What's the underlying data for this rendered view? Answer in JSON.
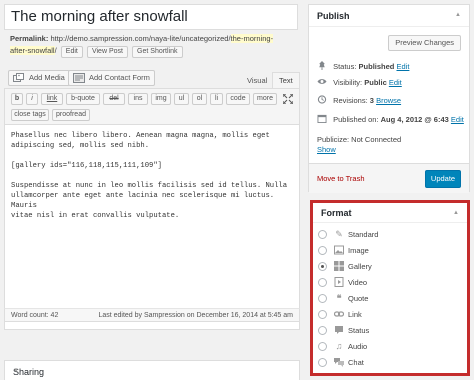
{
  "title": "The morning after snowfall",
  "permalink": {
    "label": "Permalink:",
    "base": "http://demo.sampression.com/naya-lite/uncategorized/",
    "slug_part1": "the-morning-",
    "slug_part2": "after-snowfall",
    "trail": "/",
    "edit": "Edit",
    "view_post": "View Post",
    "get_shortlink": "Get Shortlink"
  },
  "media": {
    "add_media": "Add Media",
    "add_contact_form": "Add Contact Form",
    "tab_visual": "Visual",
    "tab_text": "Text"
  },
  "quicktags": [
    "b",
    "i",
    "link",
    "b-quote",
    "del",
    "ins",
    "img",
    "ul",
    "ol",
    "li",
    "code",
    "more",
    "close tags",
    "proofread"
  ],
  "content": "Phasellus nec libero libero. Aenean magna magna, mollis eget\nadipiscing sed, mollis sed nibh.\n\n[gallery ids=\"116,118,115,111,109\"]\n\nSuspendisse at nunc in leo mollis facilisis sed id tellus. Nulla\nullamcorper ante eget ante lacinia nec scelerisque mi luctus. Mauris\nvitae nisl in erat convallis vulputate.",
  "status_bar": {
    "word_count": "Word count: 42",
    "last_edited": "Last edited by Sampression on December 16, 2014 at 5:45 am"
  },
  "sharing": {
    "title": "Sharing"
  },
  "publish": {
    "title": "Publish",
    "preview": "Preview Changes",
    "status_label": "Status:",
    "status_value": "Published",
    "status_edit": "Edit",
    "visibility_label": "Visibility:",
    "visibility_value": "Public",
    "visibility_edit": "Edit",
    "revisions_label": "Revisions:",
    "revisions_value": "3",
    "revisions_browse": "Browse",
    "published_label": "Published on:",
    "published_value": "Aug 4, 2012 @ 6:43",
    "published_edit": "Edit",
    "publicize": "Publicize: Not Connected",
    "show": "Show",
    "trash": "Move to Trash",
    "update": "Update"
  },
  "format": {
    "title": "Format",
    "options": [
      {
        "label": "Standard",
        "icon": "pin-icon",
        "selected": false
      },
      {
        "label": "Image",
        "icon": "image-icon",
        "selected": false
      },
      {
        "label": "Gallery",
        "icon": "gallery-icon",
        "selected": true
      },
      {
        "label": "Video",
        "icon": "video-icon",
        "selected": false
      },
      {
        "label": "Quote",
        "icon": "quote-icon",
        "selected": false
      },
      {
        "label": "Link",
        "icon": "link-icon",
        "selected": false
      },
      {
        "label": "Status",
        "icon": "status-icon",
        "selected": false
      },
      {
        "label": "Audio",
        "icon": "audio-icon",
        "selected": false
      },
      {
        "label": "Chat",
        "icon": "chat-icon",
        "selected": false
      }
    ]
  },
  "colors": {
    "accent": "#0085ba",
    "link": "#0073aa",
    "highlight_border": "#c42c2c",
    "trash": "#a00000"
  }
}
